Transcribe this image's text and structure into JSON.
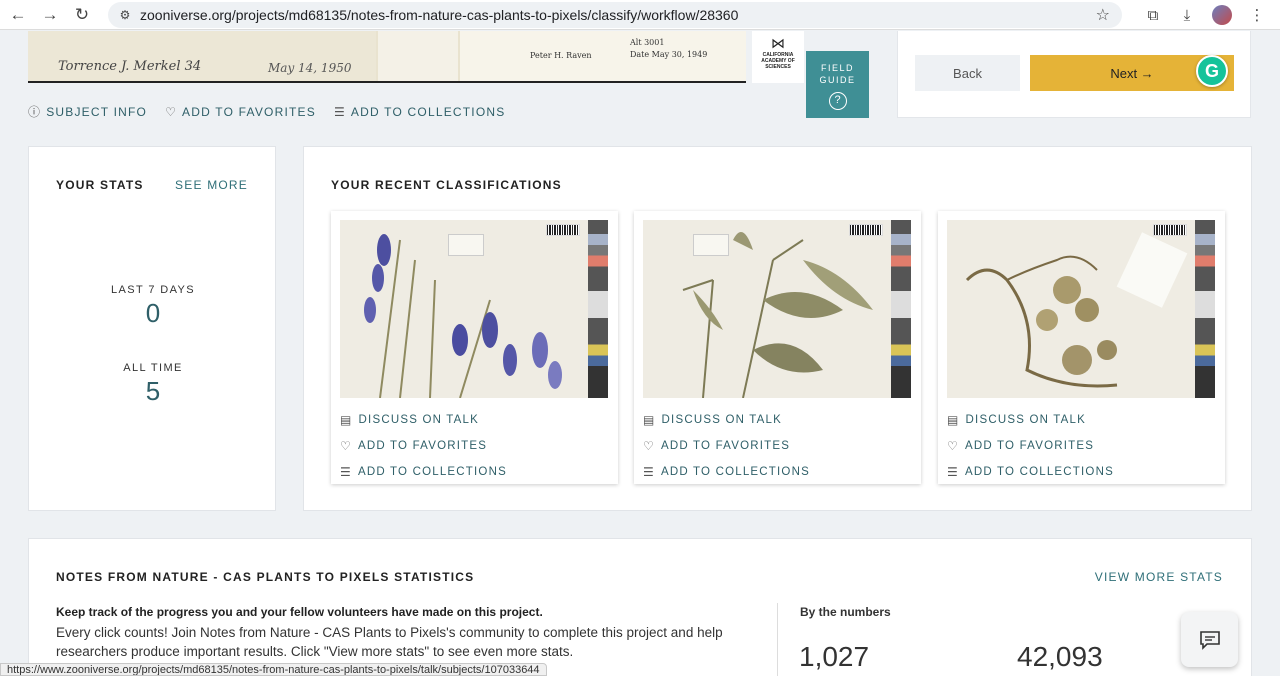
{
  "browser": {
    "url": "zooniverse.org/projects/md68135/notes-from-nature-cas-plants-to-pixels/classify/workflow/28360",
    "back_icon": "←",
    "forward_icon": "→",
    "reload_icon": "↻",
    "site_info_icon": "⚙",
    "star_icon": "☆",
    "extensions_icon": "⧉",
    "download_icon": "⤓",
    "menu_icon": "⋮",
    "status_url": "https://www.zooniverse.org/projects/md68135/notes-from-nature-cas-plants-to-pixels/talk/subjects/107033644"
  },
  "specimen": {
    "collector": "Torrence J. Merkel 34",
    "collector_date": "May 14, 1950",
    "label_collector": "Peter H. Raven",
    "alt": "Alt 3001",
    "date": "Date May 30, 1949",
    "logo_text": "CALIFORNIA ACADEMY OF SCIENCES"
  },
  "field_guide": {
    "label": "FIELD GUIDE",
    "icon": "?"
  },
  "subject_actions": [
    {
      "icon": "ⓘ",
      "label": "SUBJECT INFO"
    },
    {
      "icon": "♡",
      "label": "ADD TO FAVORITES"
    },
    {
      "icon": "☰",
      "label": "ADD TO COLLECTIONS"
    }
  ],
  "nav": {
    "back": "Back",
    "next": "Next →"
  },
  "grammarly": "G",
  "your_stats": {
    "title": "YOUR STATS",
    "see_more": "SEE MORE",
    "last7_label": "LAST 7 DAYS",
    "last7_value": "0",
    "all_time_label": "ALL TIME",
    "all_time_value": "5"
  },
  "recent": {
    "title": "YOUR RECENT CLASSIFICATIONS",
    "items": [
      {
        "discuss": "DISCUSS ON TALK",
        "favorite": "ADD TO FAVORITES",
        "collect": "ADD TO COLLECTIONS"
      },
      {
        "discuss": "DISCUSS ON TALK",
        "favorite": "ADD TO FAVORITES",
        "collect": "ADD TO COLLECTIONS"
      },
      {
        "discuss": "DISCUSS ON TALK",
        "favorite": "ADD TO FAVORITES",
        "collect": "ADD TO COLLECTIONS"
      }
    ]
  },
  "project_stats": {
    "title": "NOTES FROM NATURE - CAS PLANTS TO PIXELS STATISTICS",
    "view_more": "VIEW MORE STATS",
    "lead": "Keep track of the progress you and your fellow volunteers have made on this project.",
    "description": "Every click counts! Join Notes from Nature - CAS Plants to Pixels's community to complete this project and help researchers produce important results. Click \"View more stats\" to see even more stats.",
    "by_numbers": "By the numbers",
    "number1": "1,027",
    "number2": "42,093"
  },
  "chat_icon": "▭"
}
